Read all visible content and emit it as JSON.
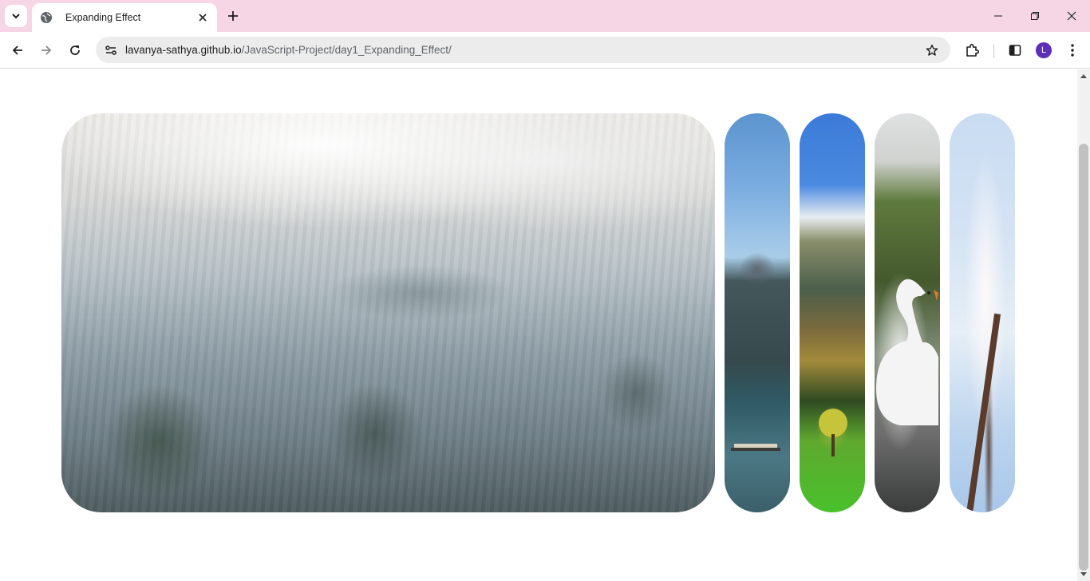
{
  "browser": {
    "tab": {
      "title": "Expanding Effect"
    },
    "url": {
      "host": "lavanya-sathya.github.io",
      "path": "/JavaScript-Project/day1_Expanding_Effect/"
    },
    "profile": {
      "initial": "L",
      "color": "#5c2fb8"
    },
    "tabbar_color": "#f6d6e4",
    "icons": [
      "tab-search-icon",
      "globe-icon",
      "close-icon",
      "plus-icon",
      "minimize-icon",
      "restore-icon",
      "back-arrow-icon",
      "forward-arrow-icon",
      "reload-icon",
      "site-info-icon",
      "star-icon",
      "extensions-icon",
      "side-panel-icon",
      "kebab-menu-icon"
    ]
  },
  "page": {
    "panels": [
      {
        "id": "panel-1",
        "active": true,
        "scene": "frosty forest",
        "title": ""
      },
      {
        "id": "panel-2",
        "active": false,
        "scene": "mountain lake",
        "title": ""
      },
      {
        "id": "panel-3",
        "active": false,
        "scene": "alpine meadow",
        "title": ""
      },
      {
        "id": "panel-4",
        "active": false,
        "scene": "white swan",
        "title": ""
      },
      {
        "id": "panel-5",
        "active": false,
        "scene": "blossom tree",
        "title": ""
      }
    ]
  }
}
